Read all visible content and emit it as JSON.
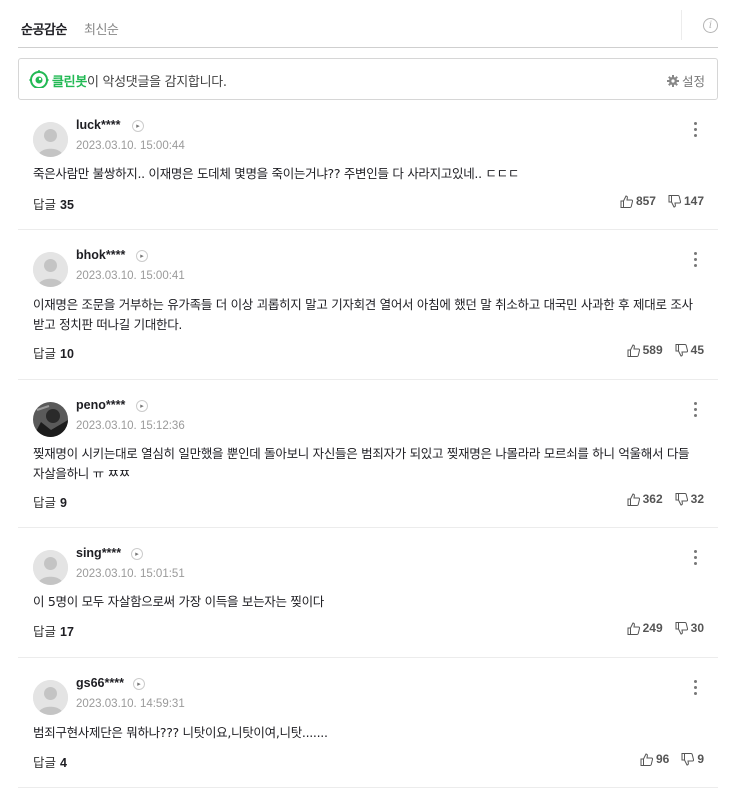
{
  "sort": {
    "active": "순공감순",
    "inactive": "최신순",
    "info": "i"
  },
  "cleanbot": {
    "brand": "클린봇",
    "message": "이 악성댓글을 감지합니다.",
    "settings": "설정"
  },
  "comments": [
    {
      "nick": "luck****",
      "date": "2023.03.10. 15:00:44",
      "text": "죽은사람만 불쌍하지.. 이재명은 도데체 몇명을 죽이는거냐?? 주변인들 다 사라지고있네.. ㄷㄷㄷ",
      "reply_label": "답글",
      "reply_count": "35",
      "likes": "857",
      "dislikes": "147",
      "avatar": "default"
    },
    {
      "nick": "bhok****",
      "date": "2023.03.10. 15:00:41",
      "text": "이재명은 조문을 거부하는 유가족들 더 이상 괴롭히지 말고 기자회견 열어서 아침에 했던 말 취소하고 대국민 사과한 후 제대로 조사 받고 정치판 떠나길 기대한다.",
      "reply_label": "답글",
      "reply_count": "10",
      "likes": "589",
      "dislikes": "45",
      "avatar": "default"
    },
    {
      "nick": "peno****",
      "date": "2023.03.10. 15:12:36",
      "text": "찢재명이 시키는대로 열심히 일만했을 뿐인데 돌아보니 자신들은 범죄자가 되있고 찢재명은 나몰라라 모르쇠를 하니 억울해서 다들 자살을하니 ㅠ ㅉㅉ",
      "reply_label": "답글",
      "reply_count": "9",
      "likes": "362",
      "dislikes": "32",
      "avatar": "photo"
    },
    {
      "nick": "sing****",
      "date": "2023.03.10. 15:01:51",
      "text": "이 5명이 모두 자살함으로써 가장 이득을 보는자는 찢이다",
      "reply_label": "답글",
      "reply_count": "17",
      "likes": "249",
      "dislikes": "30",
      "avatar": "default"
    },
    {
      "nick": "gs66****",
      "date": "2023.03.10. 14:59:31",
      "text": "범죄구현사제단은 뭐하나??? 니탓이요,니탓이여,니탓.......",
      "reply_label": "답글",
      "reply_count": "4",
      "likes": "96",
      "dislikes": "9",
      "avatar": "default"
    }
  ]
}
